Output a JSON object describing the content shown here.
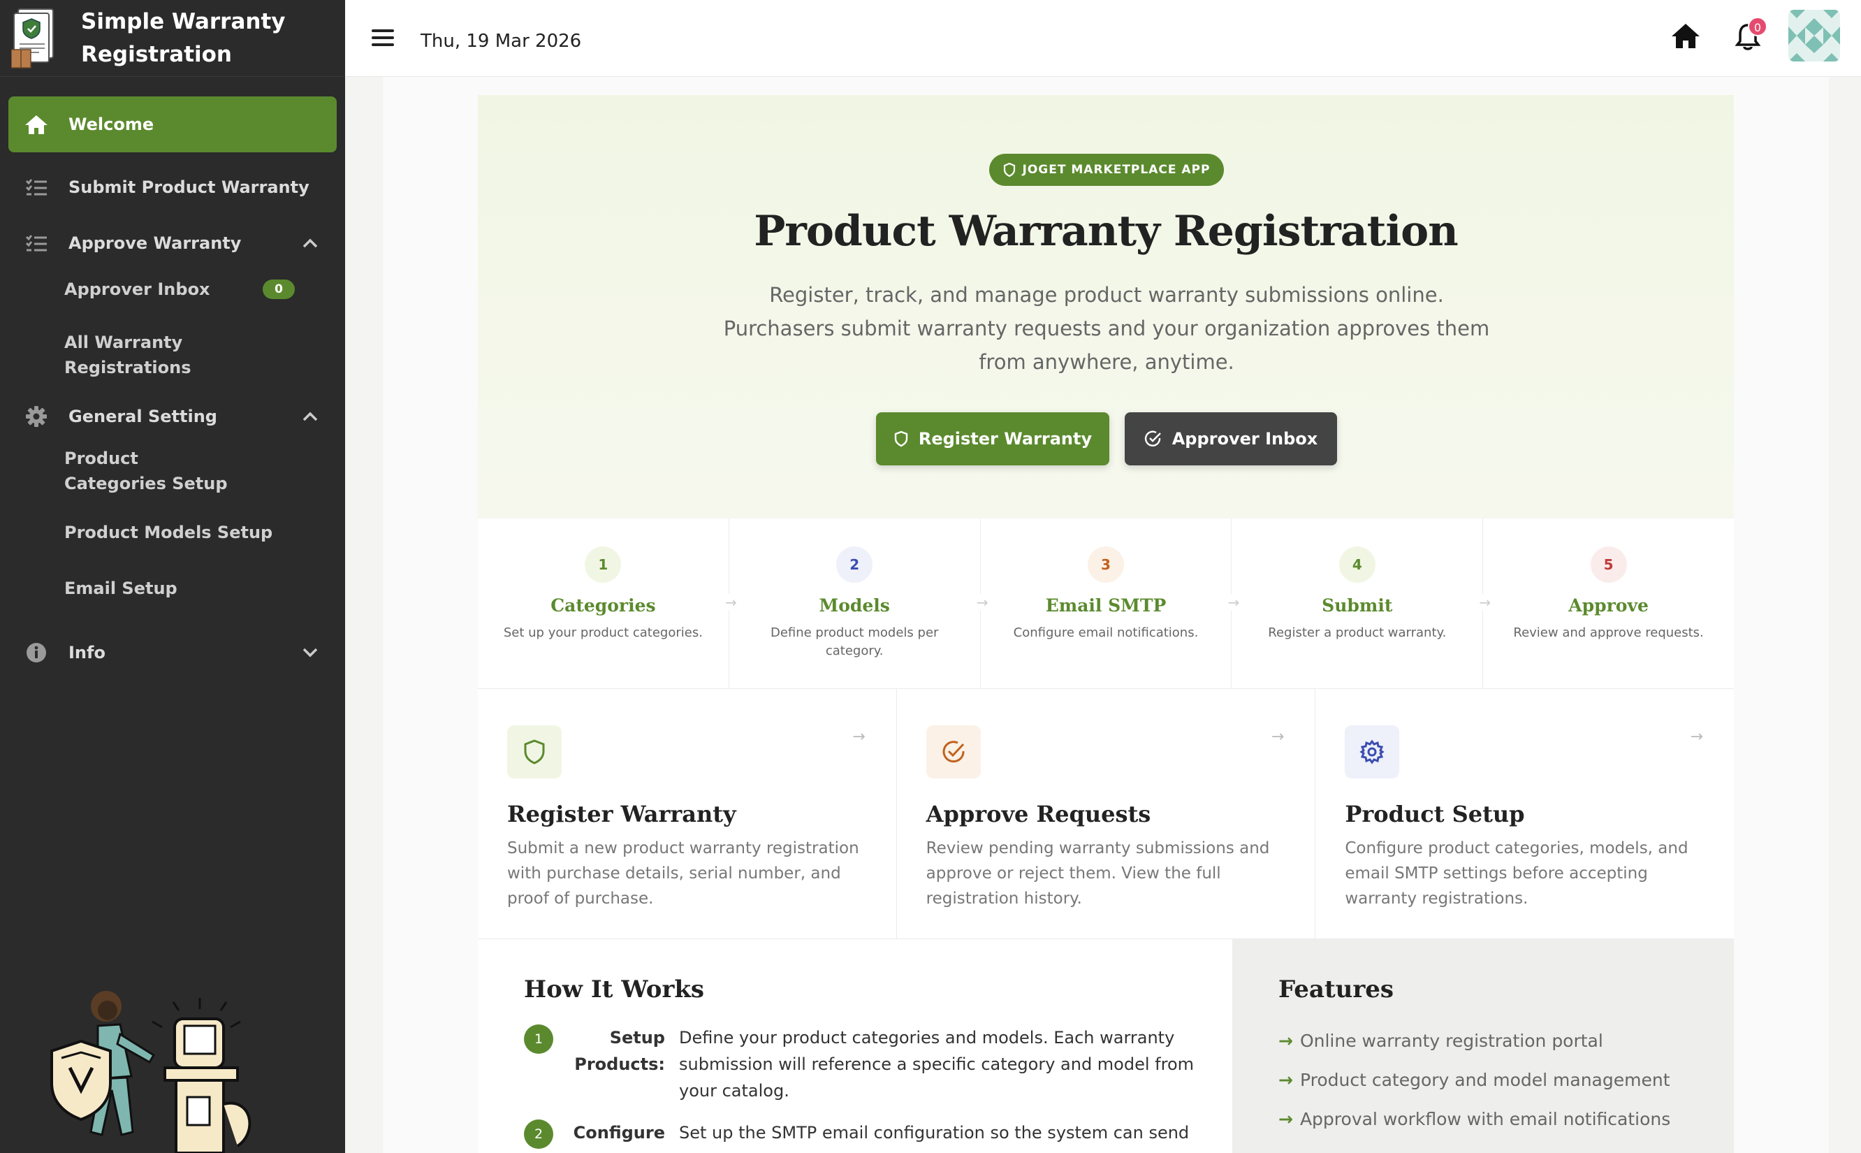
{
  "app": {
    "title": "Simple Warranty Registration"
  },
  "sidebar": {
    "items": [
      {
        "label": "Welcome",
        "icon": "home-icon"
      },
      {
        "label": "Submit Product Warranty",
        "icon": "list-icon"
      },
      {
        "label": "Approve Warranty",
        "icon": "list-icon"
      },
      {
        "label": "General Setting",
        "icon": "gear-icon"
      },
      {
        "label": "Info",
        "icon": "info-icon"
      }
    ],
    "approve_sub": [
      {
        "label": "Approver Inbox",
        "badge": "0"
      },
      {
        "label": "All Warranty Registrations"
      }
    ],
    "setting_sub": [
      {
        "label": "Product Categories Setup"
      },
      {
        "label": "Product Models Setup"
      },
      {
        "label": "Email Setup"
      }
    ]
  },
  "topbar": {
    "date": "Thu, 19 Mar 2026",
    "notifications": "0"
  },
  "hero": {
    "pill": "JOGET MARKETPLACE APP",
    "title": "Product Warranty Registration",
    "description": "Register, track, and manage product warranty submissions online. Purchasers submit warranty requests and your organization approves them from anywhere, anytime.",
    "primary_button": "Register Warranty",
    "secondary_button": "Approver Inbox"
  },
  "steps": [
    {
      "num": "1",
      "title": "Categories",
      "desc": "Set up your product categories.",
      "color": "#5b8a2e",
      "bg": "#f1f6e4"
    },
    {
      "num": "2",
      "title": "Models",
      "desc": "Define product models per category.",
      "color": "#3a4db0",
      "bg": "#eef0fa"
    },
    {
      "num": "3",
      "title": "Email SMTP",
      "desc": "Configure email notifications.",
      "color": "#c0621e",
      "bg": "#fbf1e6"
    },
    {
      "num": "4",
      "title": "Submit",
      "desc": "Register a product warranty.",
      "color": "#5b8a2e",
      "bg": "#f1f6e4"
    },
    {
      "num": "5",
      "title": "Approve",
      "desc": "Review and approve requests.",
      "color": "#c23a3a",
      "bg": "#fbecec"
    }
  ],
  "cards": [
    {
      "title": "Register Warranty",
      "desc": "Submit a new product warranty registration with purchase details, serial number, and proof of purchase.",
      "icon": "shield-icon"
    },
    {
      "title": "Approve Requests",
      "desc": "Review pending warranty submissions and approve or reject them. View the full registration history.",
      "icon": "check-circle-icon"
    },
    {
      "title": "Product Setup",
      "desc": "Configure product categories, models, and email SMTP settings before accepting warranty registrations.",
      "icon": "gear-icon"
    }
  ],
  "how": {
    "title": "How It Works",
    "rows": [
      {
        "num": "1",
        "label": "Setup Products:",
        "text": "Define your product categories and models. Each warranty submission will reference a specific category and model from your catalog."
      },
      {
        "num": "2",
        "label": "Configure",
        "text": "Set up the SMTP email configuration so the system can send"
      }
    ]
  },
  "features": {
    "title": "Features",
    "items": [
      "Online warranty registration portal",
      "Product category and model management",
      "Approval workflow with email notifications"
    ]
  }
}
